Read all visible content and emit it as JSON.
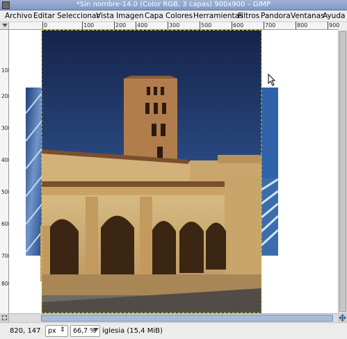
{
  "window": {
    "title": "*Sin nombre-14.0 (Color RGB, 3 capas) 900x900 – GIMP"
  },
  "menu": [
    {
      "label": "Archivo"
    },
    {
      "label": "Editar"
    },
    {
      "label": "Seleccionar"
    },
    {
      "label": "Vista"
    },
    {
      "label": "Imagen"
    },
    {
      "label": "Capa"
    },
    {
      "label": "Colores"
    },
    {
      "label": "Herramientas"
    },
    {
      "label": "Filtros"
    },
    {
      "label": "Pandora"
    },
    {
      "label": "Ventanas"
    },
    {
      "label": "Ayuda"
    }
  ],
  "ruler_top": [
    "0",
    "100",
    "200",
    "300",
    "400",
    "500",
    "600",
    "700",
    "800",
    "900"
  ],
  "ruler_left": [
    "100",
    "200",
    "300",
    "400",
    "500",
    "600",
    "700",
    "800"
  ],
  "status": {
    "coords": "820, 147",
    "unit": "px",
    "zoom": "66,7 %",
    "layer_info": "iglesia (15,4 MiB)"
  },
  "icons": {
    "app": "gimp-icon",
    "cursor": "arrow-cursor-icon"
  }
}
